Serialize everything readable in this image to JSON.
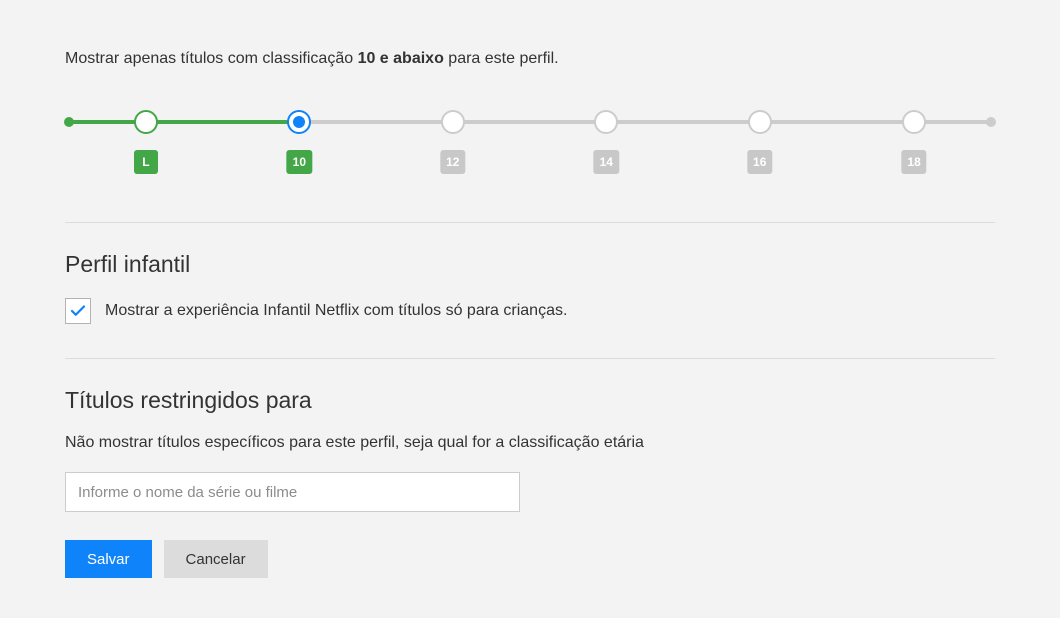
{
  "description": {
    "prefix": "Mostrar apenas títulos com classificação ",
    "bold": "10 e abaixo",
    "suffix": " para este perfil."
  },
  "slider": {
    "selected_index": 1,
    "options": [
      {
        "label": "L",
        "position_pct": 8.7,
        "active": true
      },
      {
        "label": "10",
        "position_pct": 25.2,
        "active": true
      },
      {
        "label": "12",
        "position_pct": 41.7,
        "active": false
      },
      {
        "label": "14",
        "position_pct": 58.2,
        "active": false
      },
      {
        "label": "16",
        "position_pct": 74.7,
        "active": false
      },
      {
        "label": "18",
        "position_pct": 91.3,
        "active": false
      }
    ]
  },
  "kids_profile": {
    "title": "Perfil infantil",
    "checked": true,
    "label": "Mostrar a experiência Infantil Netflix com títulos só para crianças."
  },
  "restricted": {
    "title": "Títulos restringidos para",
    "subtitle": "Não mostrar títulos específicos para este perfil, seja qual for a classificação etária",
    "placeholder": "Informe o nome da série ou filme"
  },
  "buttons": {
    "save": "Salvar",
    "cancel": "Cancelar"
  }
}
